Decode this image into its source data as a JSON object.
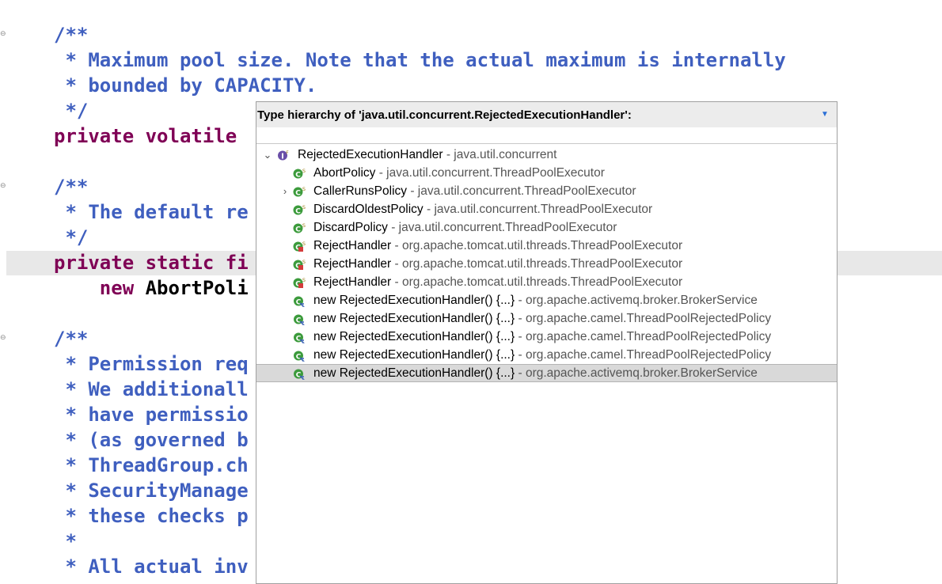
{
  "editor": {
    "lines": [
      {
        "text": "/**",
        "cls": "c-doc"
      },
      {
        "text": " * Maximum pool size. Note that the actual maximum is internally",
        "cls": "c-doc"
      },
      {
        "text": " * bounded by CAPACITY.",
        "cls": "c-doc"
      },
      {
        "text": " */",
        "cls": "c-doc"
      },
      {
        "parts": [
          {
            "text": "private volatile ",
            "cls": "c-kw"
          }
        ]
      },
      {
        "text": "",
        "cls": "c-doc"
      },
      {
        "text": "/**",
        "cls": "c-doc"
      },
      {
        "text": " * The default re",
        "cls": "c-doc"
      },
      {
        "text": " */",
        "cls": "c-doc"
      },
      {
        "parts": [
          {
            "text": "private static fi",
            "cls": "c-kw"
          }
        ]
      },
      {
        "parts": [
          {
            "text": "    new ",
            "cls": "c-kw"
          },
          {
            "text": "AbortPoli",
            "cls": "c-pl"
          }
        ]
      },
      {
        "text": "",
        "cls": "c-doc"
      },
      {
        "text": "/**",
        "cls": "c-doc"
      },
      {
        "text": " * Permission req",
        "cls": "c-doc"
      },
      {
        "text": " * We additionall",
        "cls": "c-doc"
      },
      {
        "text": " * have permissio",
        "cls": "c-doc"
      },
      {
        "text": " * (as governed b",
        "cls": "c-doc"
      },
      {
        "text": " * ThreadGroup.ch",
        "cls": "c-doc"
      },
      {
        "text": " * SecurityManage",
        "cls": "c-doc"
      },
      {
        "text": " * these checks p",
        "cls": "c-doc"
      },
      {
        "text": " *",
        "cls": "c-doc"
      },
      {
        "text": " * All actual inv",
        "cls": "c-doc"
      }
    ]
  },
  "popup": {
    "title": "Type hierarchy of 'java.util.concurrent.RejectedExecutionHandler':",
    "menu_icon": "triangle-down",
    "items": [
      {
        "name": "RejectedExecutionHandler",
        "pkg": " - java.util.concurrent",
        "icon": "interface",
        "depth": 0,
        "twisty": "expanded"
      },
      {
        "name": "AbortPolicy",
        "pkg": " - java.util.concurrent.ThreadPoolExecutor",
        "icon": "class-static",
        "depth": 1,
        "twisty": "none"
      },
      {
        "name": "CallerRunsPolicy",
        "pkg": " - java.util.concurrent.ThreadPoolExecutor",
        "icon": "class-static",
        "depth": 1,
        "twisty": "collapsed"
      },
      {
        "name": "DiscardOldestPolicy",
        "pkg": " - java.util.concurrent.ThreadPoolExecutor",
        "icon": "class-static",
        "depth": 1,
        "twisty": "none"
      },
      {
        "name": "DiscardPolicy",
        "pkg": " - java.util.concurrent.ThreadPoolExecutor",
        "icon": "class-static",
        "depth": 1,
        "twisty": "none"
      },
      {
        "name": "RejectHandler",
        "pkg": " - org.apache.tomcat.util.threads.ThreadPoolExecutor",
        "icon": "class-static-private",
        "depth": 1,
        "twisty": "none"
      },
      {
        "name": "RejectHandler",
        "pkg": " - org.apache.tomcat.util.threads.ThreadPoolExecutor",
        "icon": "class-static-private",
        "depth": 1,
        "twisty": "none"
      },
      {
        "name": "RejectHandler",
        "pkg": " - org.apache.tomcat.util.threads.ThreadPoolExecutor",
        "icon": "class-static-private",
        "depth": 1,
        "twisty": "none"
      },
      {
        "name": "new RejectedExecutionHandler() {...}",
        "pkg": " - org.apache.activemq.broker.BrokerService",
        "icon": "anonymous-class",
        "depth": 1,
        "twisty": "none"
      },
      {
        "name": "new RejectedExecutionHandler() {...}",
        "pkg": " - org.apache.camel.ThreadPoolRejectedPolicy",
        "icon": "anonymous-class",
        "depth": 1,
        "twisty": "none"
      },
      {
        "name": "new RejectedExecutionHandler() {...}",
        "pkg": " - org.apache.camel.ThreadPoolRejectedPolicy",
        "icon": "anonymous-class",
        "depth": 1,
        "twisty": "none"
      },
      {
        "name": "new RejectedExecutionHandler() {...}",
        "pkg": " - org.apache.camel.ThreadPoolRejectedPolicy",
        "icon": "anonymous-class",
        "depth": 1,
        "twisty": "none"
      },
      {
        "name": "new RejectedExecutionHandler() {...}",
        "pkg": " - org.apache.activemq.broker.BrokerService",
        "icon": "anonymous-class",
        "depth": 1,
        "twisty": "none",
        "selected": true
      }
    ]
  },
  "colors": {
    "javadoc": "#3f5fbf",
    "keyword": "#7f0055",
    "class_icon": "#3c9b3c",
    "interface_icon": "#6a4fa8",
    "private_marker": "#d43b3b"
  }
}
